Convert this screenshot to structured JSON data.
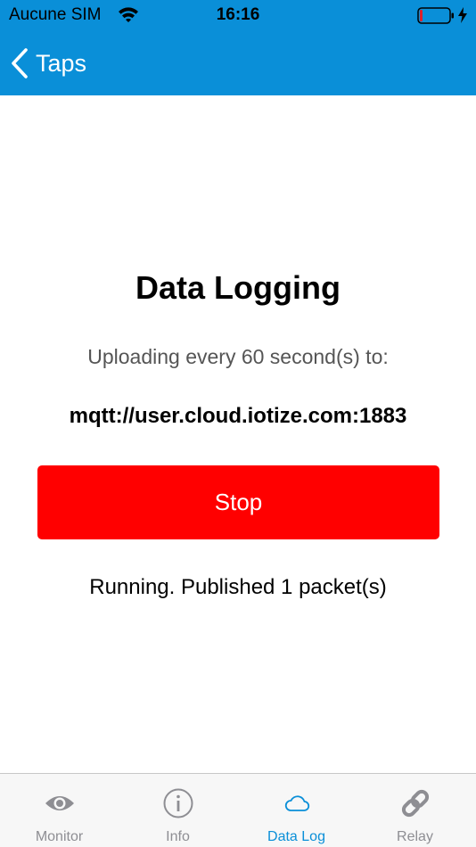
{
  "status_bar": {
    "carrier": "Aucune SIM",
    "time": "16:16",
    "wifi_icon": "wifi-icon",
    "battery_icon": "battery-icon",
    "charging_icon": "charging-bolt-icon"
  },
  "nav": {
    "back_label": "Taps",
    "back_icon": "chevron-left-icon"
  },
  "main": {
    "title": "Data Logging",
    "subtitle": "Uploading every 60 second(s) to:",
    "url": "mqtt://user.cloud.iotize.com:1883",
    "button_label": "Stop",
    "status": "Running. Published 1 packet(s)"
  },
  "tabs": [
    {
      "label": "Monitor",
      "icon": "eye-icon",
      "active": false
    },
    {
      "label": "Info",
      "icon": "info-icon",
      "active": false
    },
    {
      "label": "Data Log",
      "icon": "cloud-icon",
      "active": true
    },
    {
      "label": "Relay",
      "icon": "link-icon",
      "active": false
    }
  ],
  "colors": {
    "header_bg": "#0a8fd8",
    "stop_button": "#ff0000",
    "tab_active": "#0a8fd8",
    "tab_inactive": "#8e8e93"
  }
}
